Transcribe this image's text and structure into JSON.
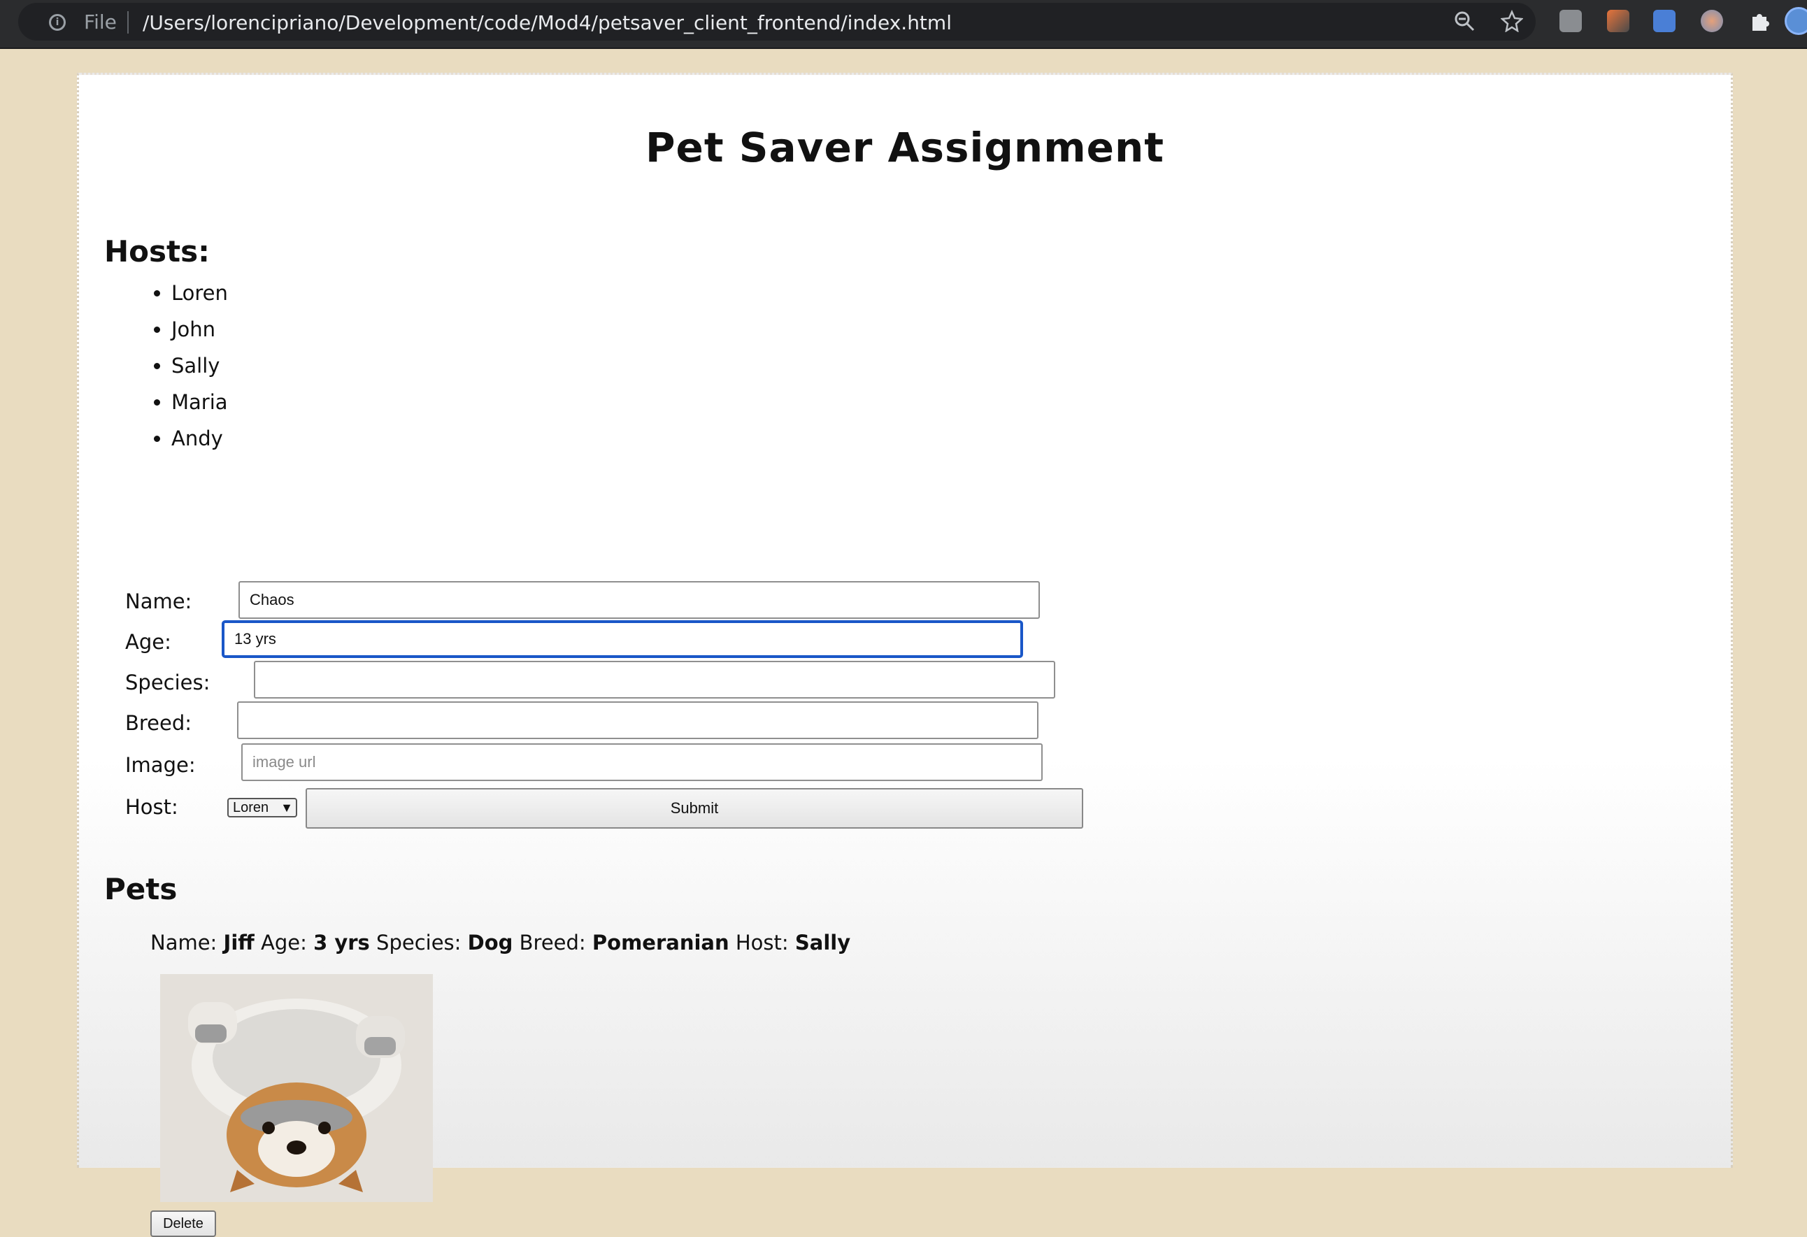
{
  "browser": {
    "file_label": "File",
    "url": "/Users/lorencipriano/Development/code/Mod4/petsaver_client_frontend/index.html",
    "icons": [
      "zoom-out-icon",
      "star-icon",
      "extension-icon",
      "extension-icon",
      "translate-icon",
      "extension-icon",
      "puzzle-icon",
      "profile-avatar"
    ]
  },
  "page": {
    "title": "Pet Saver Assignment",
    "hosts_heading": "Hosts:",
    "hosts": [
      "Loren",
      "John",
      "Sally",
      "Maria",
      "Andy"
    ]
  },
  "form": {
    "name_label": "Name:",
    "name_value": "Chaos",
    "age_label": "Age:",
    "age_value": "13 yrs",
    "species_label": "Species:",
    "species_value": "",
    "breed_label": "Breed:",
    "breed_value": "",
    "image_label": "Image:",
    "image_placeholder": "image url",
    "host_label": "Host:",
    "host_selected": "Loren",
    "submit_label": "Submit"
  },
  "pets": {
    "heading": "Pets",
    "items": [
      {
        "name_label": "Name:",
        "name": "Jiff",
        "age_label": "Age:",
        "age": "3 yrs",
        "species_label": "Species:",
        "species": "Dog",
        "breed_label": "Breed:",
        "breed": "Pomeranian",
        "host_label": "Host:",
        "host": "Sally",
        "delete_label": "Delete"
      }
    ]
  }
}
